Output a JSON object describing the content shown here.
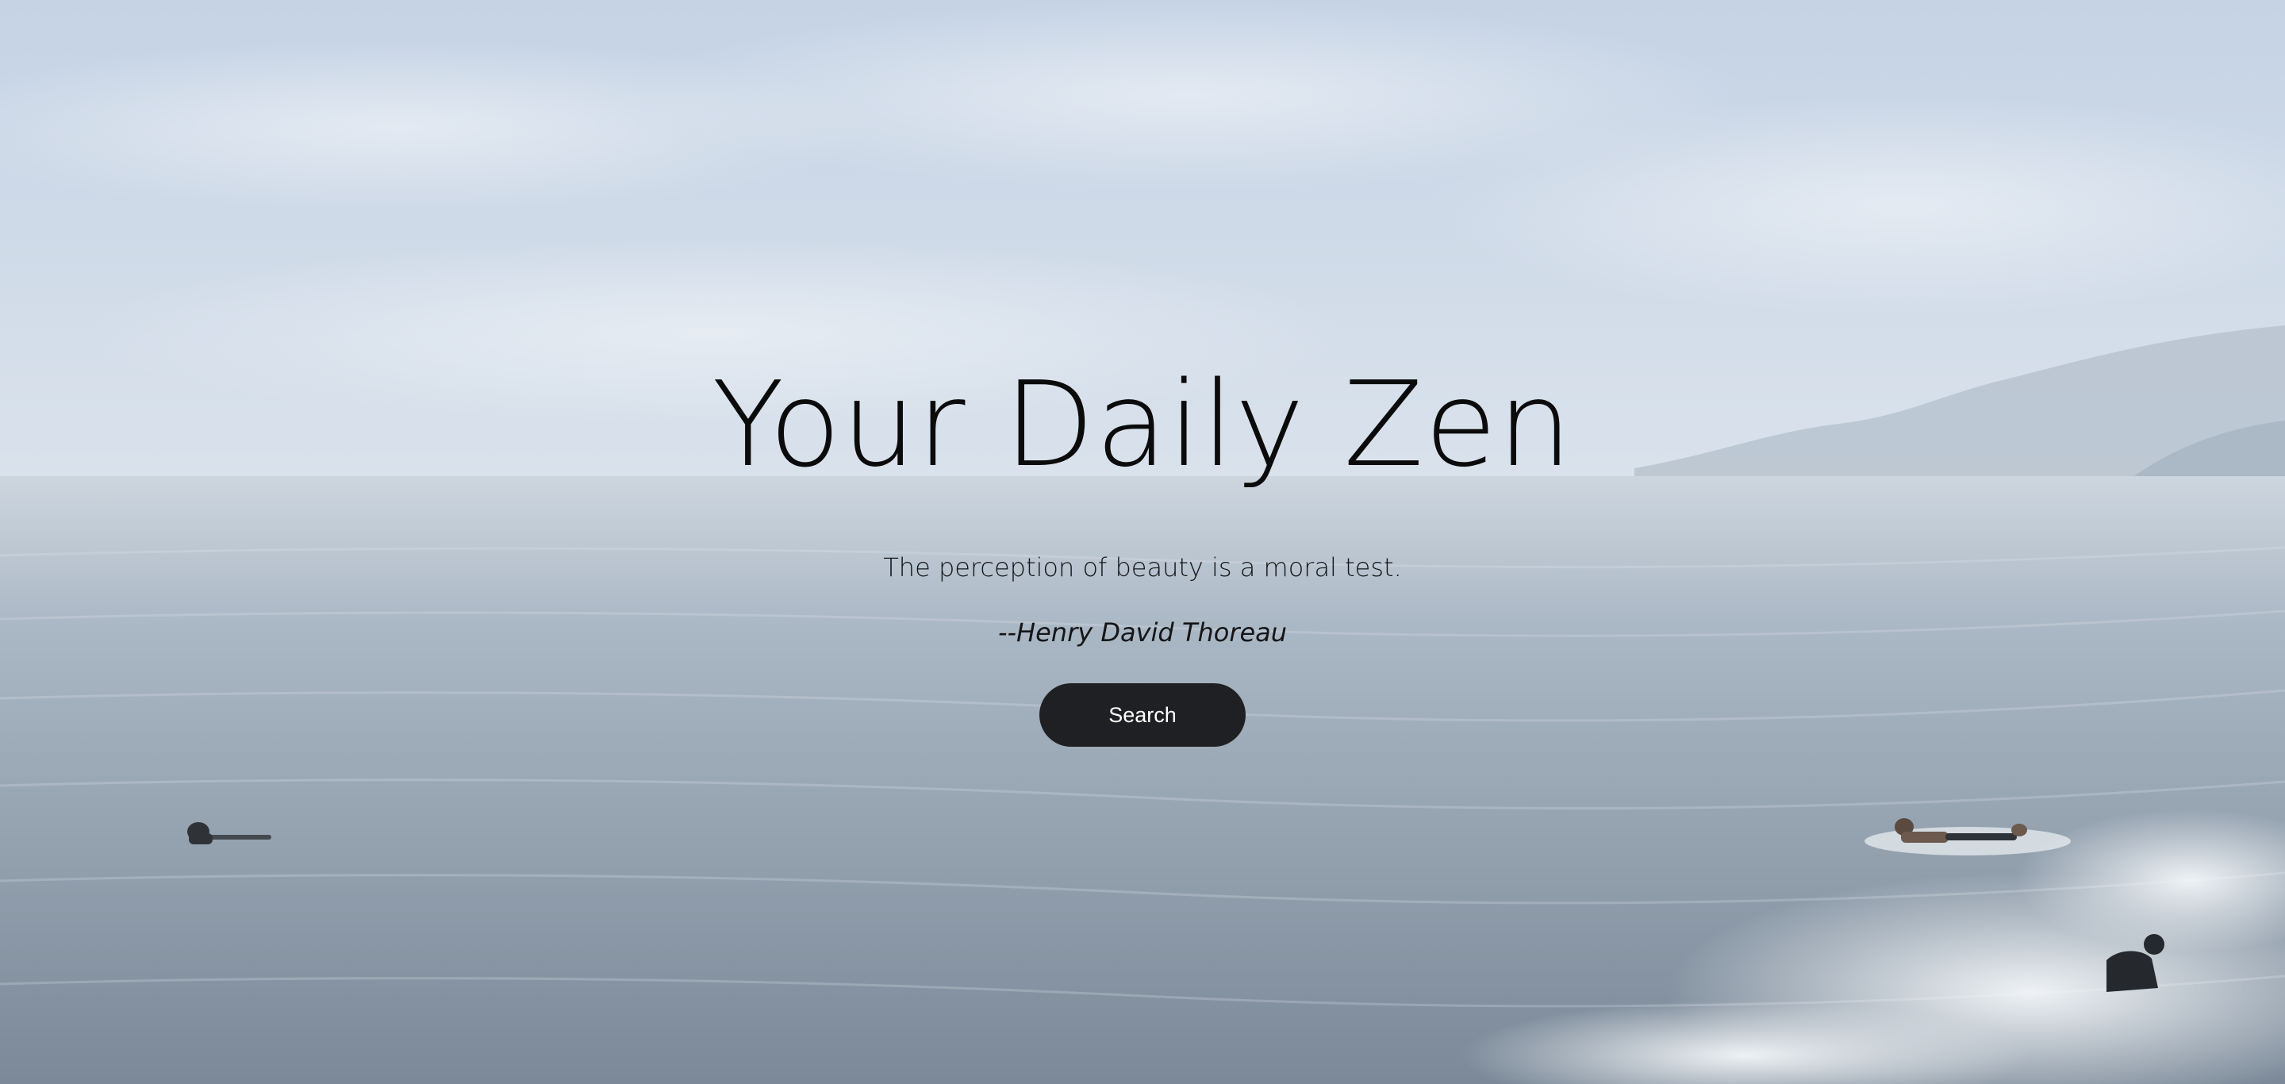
{
  "page": {
    "title": "Your Daily Zen",
    "quote": "The perception of beauty is a moral test.",
    "author": "--Henry David Thoreau",
    "search_label": "Search"
  },
  "background": {
    "subject": "hazy ocean with surfers and distant hills",
    "colors": {
      "sky_top": "#c7d5e6",
      "sky_bottom": "#d9e1ea",
      "sea_top": "#b9c6d3",
      "sea_bottom": "#7f8e9c",
      "hills": "#b4c0cc",
      "foam": "#eef2f5"
    }
  },
  "colors": {
    "title_text": "#0b0b0c",
    "button_bg": "#1f2023",
    "button_text": "#ffffff"
  }
}
